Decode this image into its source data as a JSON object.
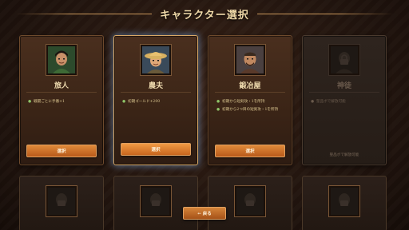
{
  "header": {
    "title": "キャラクター選択"
  },
  "cards": [
    {
      "name": "旅人",
      "perks": [
        "戦闘ごとに手番+1"
      ],
      "button": "選択",
      "icon": "traveler-portrait-icon"
    },
    {
      "name": "農夫",
      "perks": [
        "初期ゴールド+200"
      ],
      "button": "選択",
      "icon": "farmer-portrait-icon"
    },
    {
      "name": "鍛冶屋",
      "perks": [
        "初期から短剣攻・1を所持",
        "初期から2つ目の短剣攻・1を所持"
      ],
      "button": "選択",
      "icon": "blacksmith-portrait-icon"
    },
    {
      "name": "神徒",
      "perks": [
        "聖品ボで解放可能"
      ],
      "lock_note": "聖品ボで解放可能",
      "icon": "locked-portrait-icon"
    }
  ],
  "footer": {
    "back_label": "← 戻る"
  },
  "colors": {
    "accent": "#e08a3a",
    "perk_dot": "#8fc468",
    "frame": "#6e4a2c"
  }
}
